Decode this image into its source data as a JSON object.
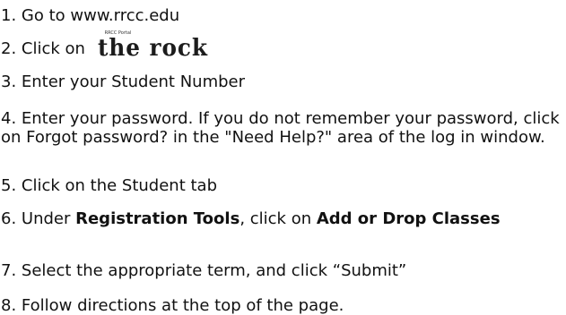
{
  "steps": {
    "s1": {
      "text": "1. Go to www.rrcc.edu"
    },
    "s2": {
      "prefix": "2. Click on ",
      "logo": {
        "portal_label": "RRCC Portal",
        "text": "the rock",
        "icon": "the-rock-logo"
      }
    },
    "s3": {
      "text": "3. Enter your Student Number"
    },
    "s4": {
      "text": "4. Enter your password. If you do not remember your password, click on Forgot password? in the \"Need Help?\" area of the log in window."
    },
    "s5": {
      "text": "5. Click on the Student tab"
    },
    "s6": {
      "prefix": "6. Under ",
      "bold1": "Registration Tools",
      "middle": ", click on ",
      "bold2": "Add or Drop Classes"
    },
    "s7": {
      "text": "7. Select the appropriate term, and click “Submit”"
    },
    "s8": {
      "text": "8. Follow directions at the top of the page."
    }
  }
}
